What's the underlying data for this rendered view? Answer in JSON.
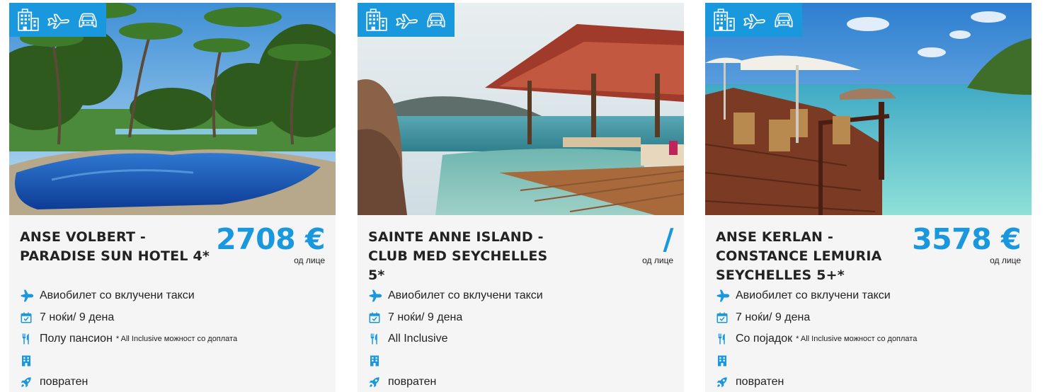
{
  "colors": {
    "accent": "#1a98de",
    "card_bg": "#f5f5f5",
    "text": "#222222"
  },
  "badge_icons": [
    "hotel-icon",
    "airplane-icon",
    "car-icon"
  ],
  "cards": [
    {
      "title": "ANSE VOLBERT - PARADISE SUN HOTEL 4*",
      "price": "2708 €",
      "price_per": "од лице",
      "features": {
        "flight": "Авиобилет со вклучени такси",
        "duration": "7 ноќи/ 9 дена",
        "board": "Полу пансион",
        "board_note": "* All Inclusive можност со доплата",
        "room": "",
        "transfer": "повратен"
      }
    },
    {
      "title": "SAINTE ANNE ISLAND - CLUB MED SEYCHELLES 5*",
      "price": "/",
      "price_per": "од лице",
      "features": {
        "flight": "Авиобилет со вклучени такси",
        "duration": "7 ноќи/ 9 дена",
        "board": "All Inclusive",
        "board_note": "",
        "room": "",
        "transfer": "повратен"
      }
    },
    {
      "title": "ANSE KERLAN - CONSTANCE LEMURIA SEYCHELLES 5+*",
      "price": "3578 €",
      "price_per": "од лице",
      "features": {
        "flight": "Авиобилет со вклучени такси",
        "duration": "7 ноќи/ 9 дена",
        "board": "Со појадок",
        "board_note": "* All Inclusive можност со доплата",
        "room": "",
        "transfer": "повратен"
      }
    }
  ]
}
